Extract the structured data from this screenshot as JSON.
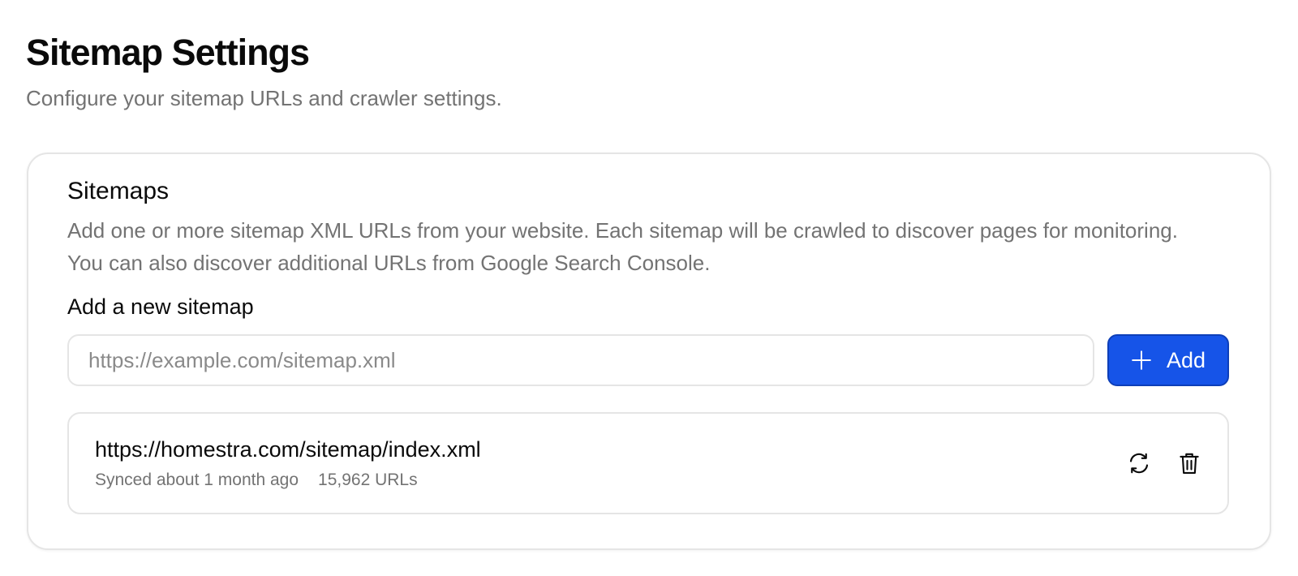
{
  "header": {
    "title": "Sitemap Settings",
    "subtitle": "Configure your sitemap URLs and crawler settings."
  },
  "sitemaps_card": {
    "title": "Sitemaps",
    "description": "Add one or more sitemap XML URLs from your website. Each sitemap will be crawled to discover pages for monitoring. You can also discover additional URLs from Google Search Console.",
    "add_label": "Add a new sitemap",
    "input": {
      "value": "",
      "placeholder": "https://example.com/sitemap.xml"
    },
    "add_button": {
      "label": "Add",
      "icon": "plus-icon"
    },
    "items": [
      {
        "url": "https://homestra.com/sitemap/index.xml",
        "synced": "Synced about 1 month ago",
        "url_count": "15,962 URLs",
        "actions": [
          "refresh-icon",
          "trash-icon"
        ]
      }
    ]
  },
  "colors": {
    "accent": "#1654e8",
    "muted_text": "#737373",
    "border": "#e5e5e5"
  }
}
